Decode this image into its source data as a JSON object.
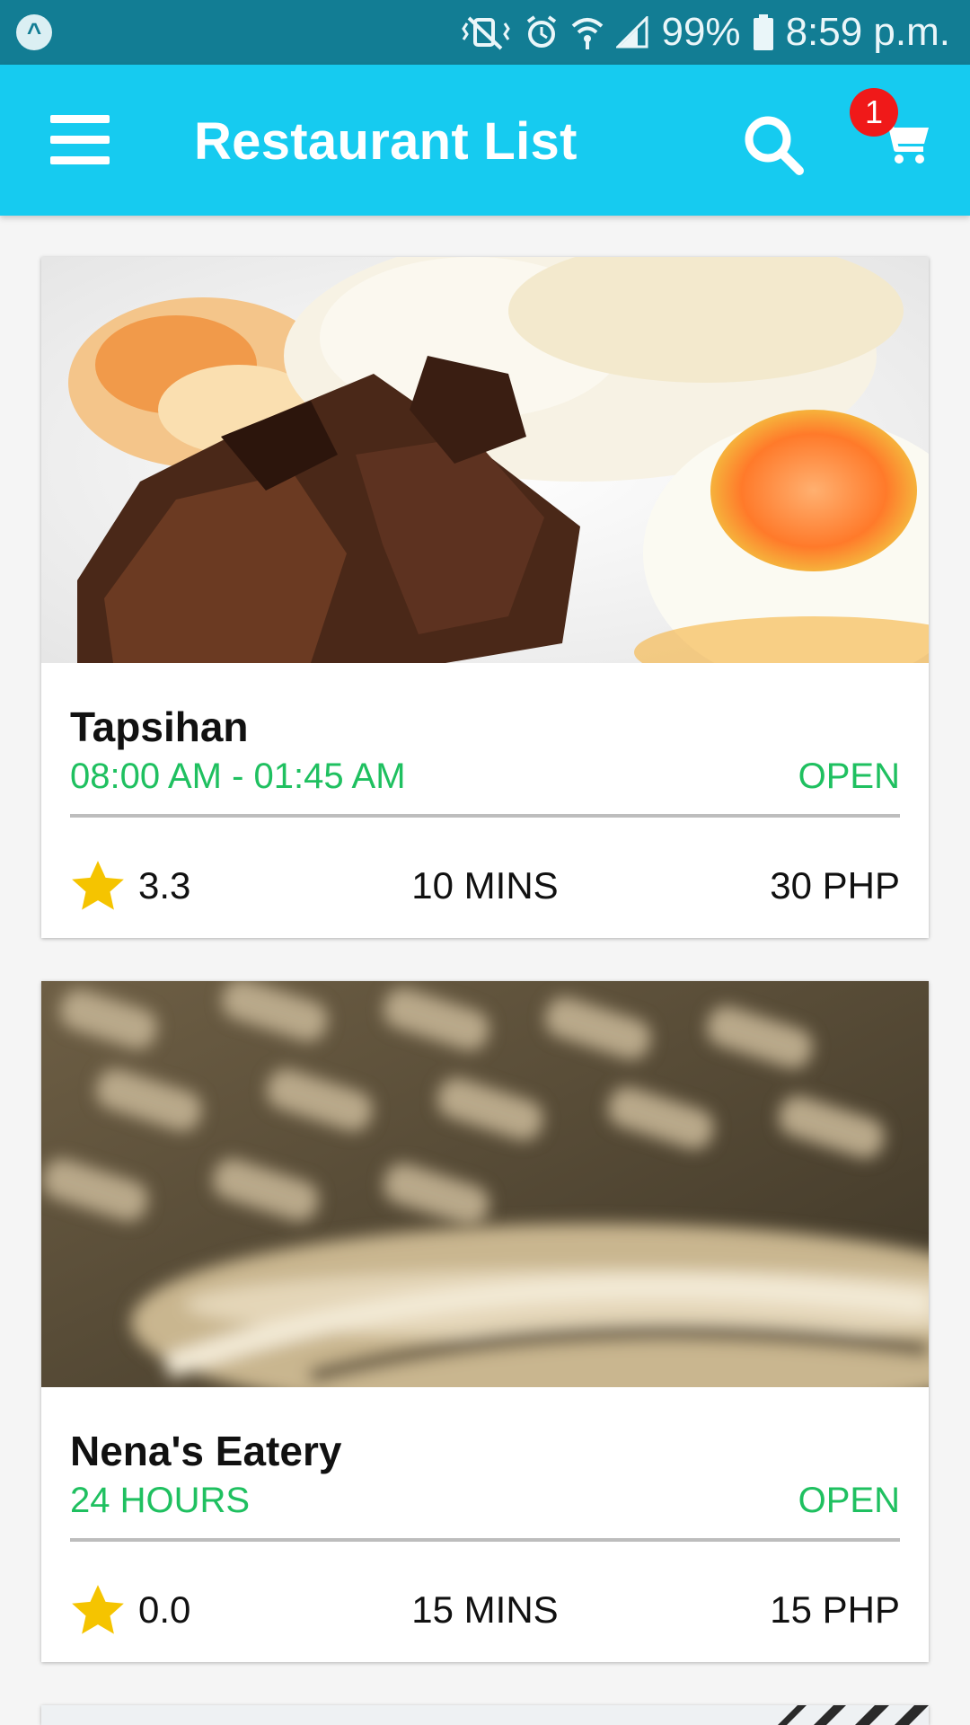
{
  "status_bar": {
    "battery": "99%",
    "time": "8:59 p.m."
  },
  "app_bar": {
    "title": "Restaurant List",
    "cart_count": "1"
  },
  "colors": {
    "status_bar": "#127d94",
    "app_bar": "#16cbf0",
    "open_status": "#1fc060",
    "badge": "#f01919",
    "star": "#f5c400"
  },
  "restaurants": [
    {
      "name": "Tapsihan",
      "hours": "08:00 AM - 01:45 AM",
      "status": "OPEN",
      "rating": "3.3",
      "delivery_time": "10 MINS",
      "price": "30 PHP"
    },
    {
      "name": "Nena's Eatery",
      "hours": "24 HOURS",
      "status": "OPEN",
      "rating": "0.0",
      "delivery_time": "15 MINS",
      "price": "15 PHP"
    }
  ]
}
